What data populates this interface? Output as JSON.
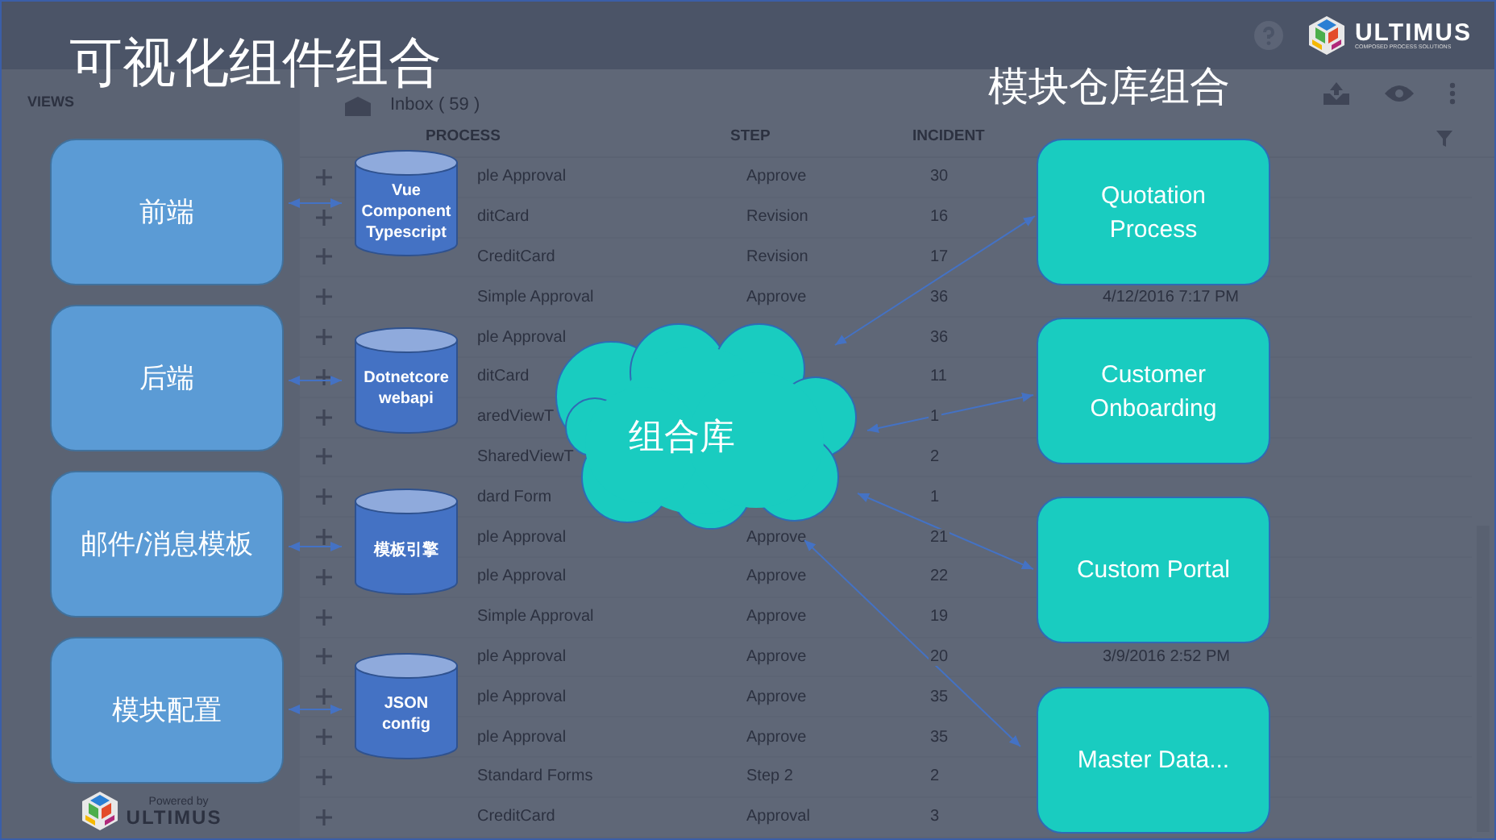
{
  "app": {
    "brand": "ULTIMUS",
    "brand_tagline": "COMPOSED PROCESS SOLUTIONS",
    "sidebar_heading": "VIEWS",
    "powered_by": "Powered by",
    "footer_logo": "ULTIMUS",
    "inbox": "Inbox ( 59 )",
    "columns": [
      "PROCESS",
      "STEP",
      "INCIDENT"
    ],
    "rows": [
      {
        "process": "ple Approval",
        "step": "Approve",
        "incident": "30"
      },
      {
        "process": "ditCard",
        "step": "Revision",
        "incident": "16"
      },
      {
        "process": "CreditCard",
        "step": "Revision",
        "incident": "17"
      },
      {
        "process": "Simple Approval",
        "step": "Approve",
        "incident": "36",
        "start": "4/12/2016 7:17 PM"
      },
      {
        "process": "ple Approval",
        "incident": "36"
      },
      {
        "process": "ditCard",
        "incident": "11"
      },
      {
        "process": "aredViewT",
        "incident": "1"
      },
      {
        "process": "SharedViewT",
        "incident": "2"
      },
      {
        "process": "dard Form",
        "incident": "1"
      },
      {
        "process": "ple Approval",
        "step": "Approve",
        "incident": "21"
      },
      {
        "process": "ple Approval",
        "step": "Approve",
        "incident": "22"
      },
      {
        "process": "Simple Approval",
        "step": "Approve",
        "incident": "19"
      },
      {
        "process": "ple Approval",
        "step": "Approve",
        "incident": "20",
        "start": "3/9/2016 2:52 PM"
      },
      {
        "process": "ple Approval",
        "step": "Approve",
        "incident": "35"
      },
      {
        "process": "ple Approval",
        "step": "Approve",
        "incident": "35"
      },
      {
        "process": "Standard Forms",
        "step": "Step 2",
        "incident": "2"
      },
      {
        "process": "CreditCard",
        "step": "Approval",
        "incident": "3"
      }
    ]
  },
  "diagram": {
    "title": "可视化组件组合",
    "repo_title": "模块仓库组合",
    "layers": [
      {
        "label": "前端",
        "store": "Vue Component Typescript"
      },
      {
        "label": "后端",
        "store": "Dotnetcore webapi"
      },
      {
        "label": "邮件/消息模板",
        "store": "模板引擎"
      },
      {
        "label": "模块配置",
        "store": "JSON config"
      }
    ],
    "library": "组合库",
    "modules": [
      "Quotation Process",
      "Customer Onboarding",
      "Custom Portal",
      "Master Data..."
    ]
  }
}
